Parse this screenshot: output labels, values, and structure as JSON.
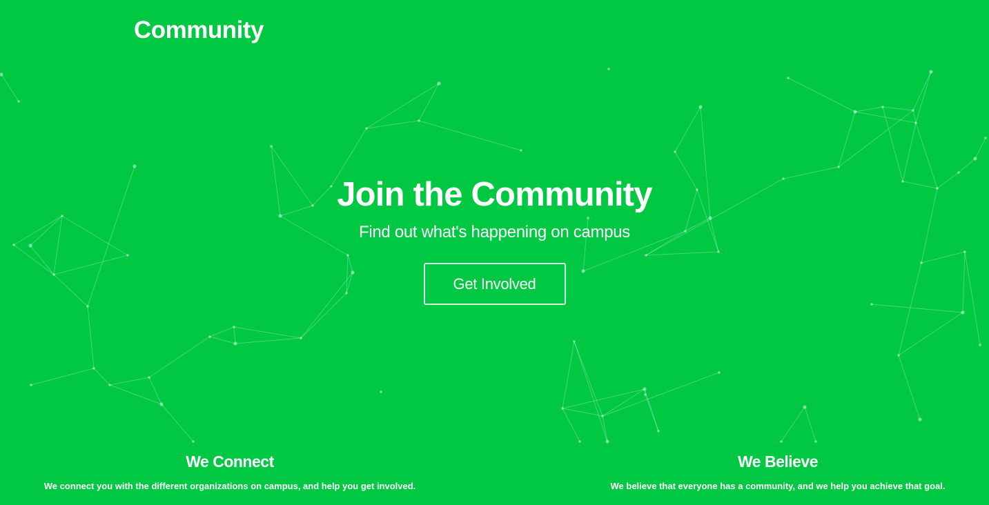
{
  "header": {
    "brand": "Community"
  },
  "hero": {
    "title": "Join the Community",
    "subtitle": "Find out what's happening on campus",
    "cta_label": "Get Involved"
  },
  "features": [
    {
      "title": "We Connect",
      "text": "We connect you with the different organizations on campus, and help you get involved."
    },
    {
      "title": "We Believe",
      "text": "We believe that everyone has a community, and we help you achieve that goal."
    }
  ],
  "colors": {
    "background": "#00c843",
    "text": "#ffffff"
  }
}
